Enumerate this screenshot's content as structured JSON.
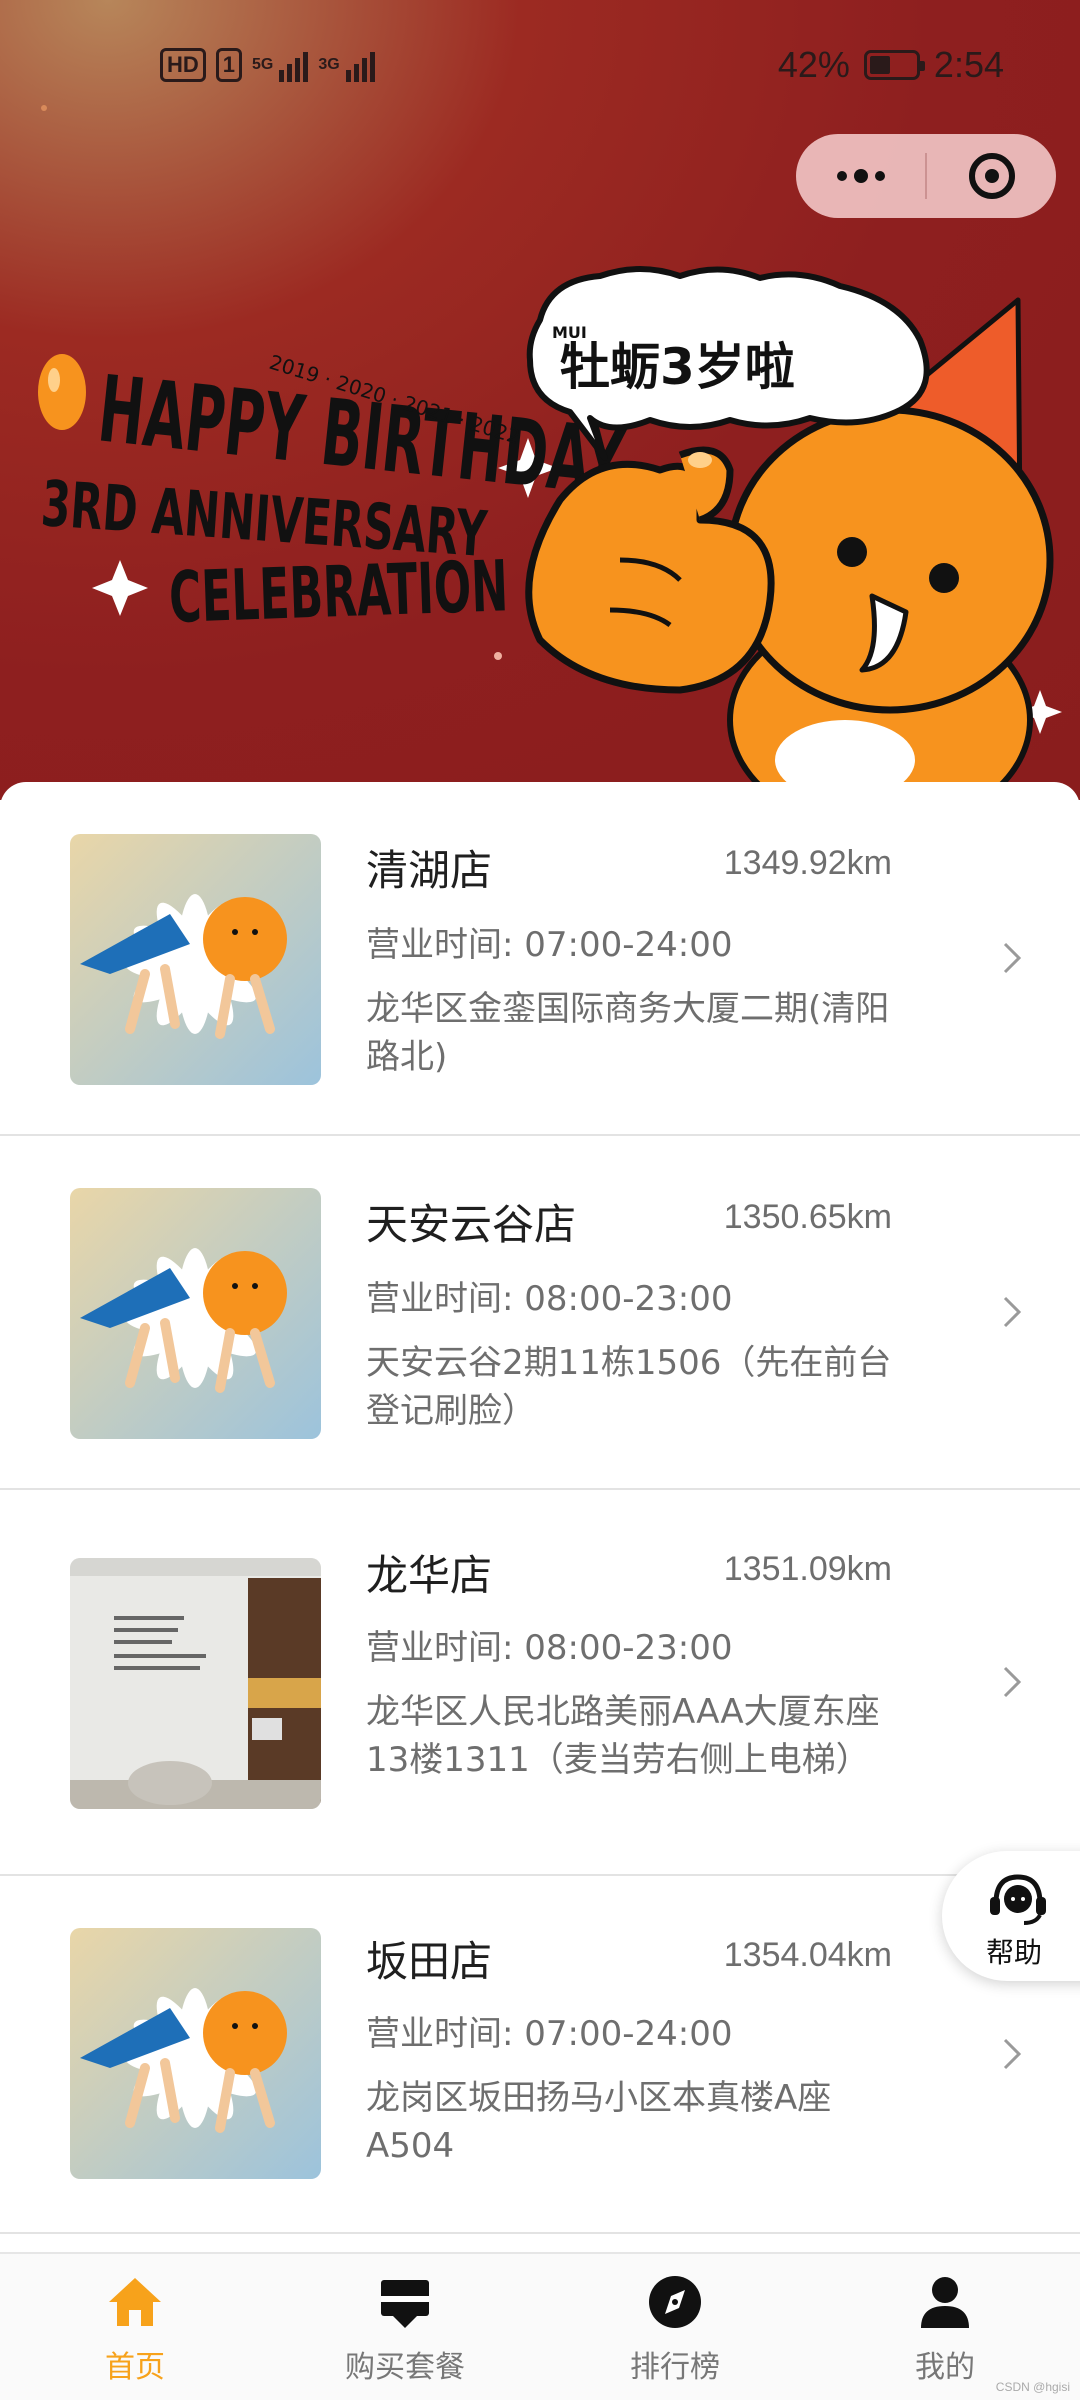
{
  "status_bar": {
    "left_badge": "HD",
    "sim_slot": "1",
    "network_1": "5G",
    "network_2": "3G",
    "battery": "42%",
    "time": "2:54"
  },
  "capsule": {
    "more_icon": "more-dots-icon",
    "close_icon": "target-close-icon"
  },
  "banner": {
    "headline_1": "HAPPY BIRTHDAY",
    "headline_2": "3RD ANNIVERSARY",
    "headline_3": "CELEBRATION",
    "years": "2019 · 2020 · 2021 · 2022",
    "bubble_small": "MUI",
    "bubble_text": "牡蛎3岁啦",
    "colors": {
      "banner_red": "#8e1f1f",
      "mascot_orange": "#f7931e",
      "accent": "#f7a21b"
    }
  },
  "stores": [
    {
      "name": "清湖店",
      "distance": "1349.92km",
      "hours": "营业时间: 07:00-24:00",
      "address": "龙华区金銮国际商务大厦二期(清阳路北)",
      "image": "daisy"
    },
    {
      "name": "天安云谷店",
      "distance": "1350.65km",
      "hours": "营业时间: 08:00-23:00",
      "address": "天安云谷2期11栋1506（先在前台登记刷脸）",
      "image": "daisy"
    },
    {
      "name": "龙华店",
      "distance": "1351.09km",
      "hours": "营业时间: 08:00-23:00",
      "address": "龙华区人民北路美丽AAA大厦东座13楼1311（麦当劳右侧上电梯）",
      "image": "room"
    },
    {
      "name": "坂田店",
      "distance": "1354.04km",
      "hours": "营业时间: 07:00-24:00",
      "address": "龙岗区坂田扬马小区本真楼A座A504",
      "image": "daisy"
    }
  ],
  "help": {
    "label": "帮助",
    "icon": "headset-icon"
  },
  "tabs": [
    {
      "label": "首页",
      "icon": "home-icon",
      "active": true
    },
    {
      "label": "购买套餐",
      "icon": "package-icon",
      "active": false
    },
    {
      "label": "排行榜",
      "icon": "compass-icon",
      "active": false
    },
    {
      "label": "我的",
      "icon": "user-icon",
      "active": false
    }
  ],
  "watermark": "CSDN @hgisi"
}
